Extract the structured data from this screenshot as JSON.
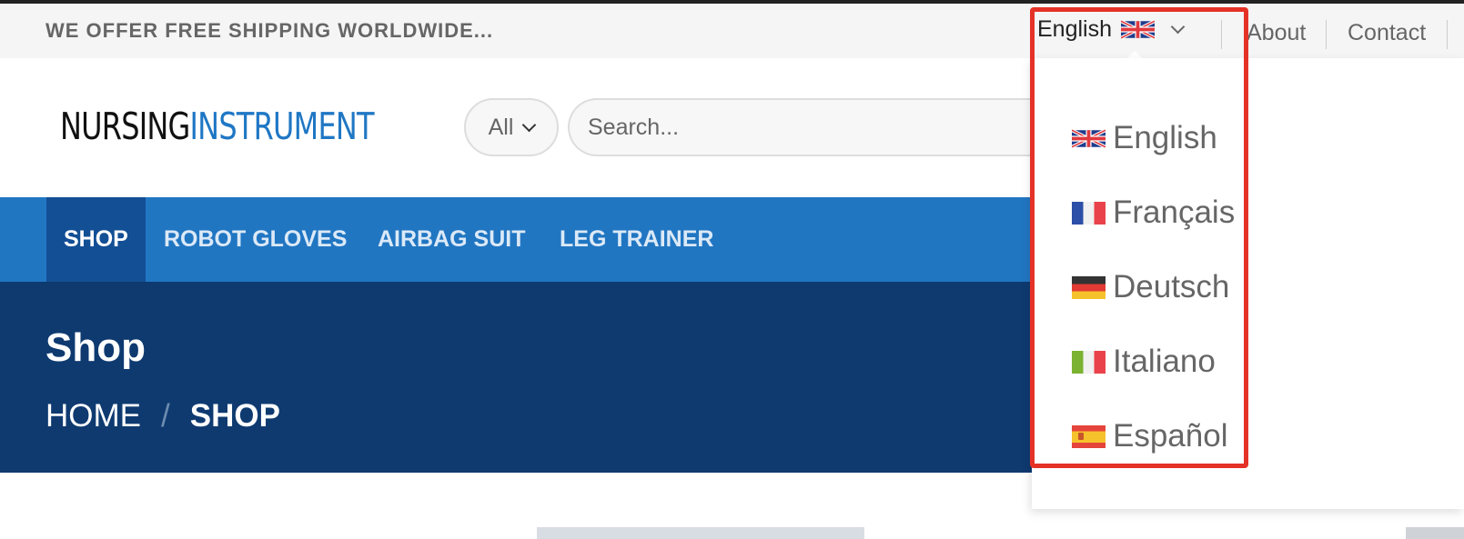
{
  "topbar": {
    "shipping_text": "WE OFFER FREE SHIPPING WORLDWIDE...",
    "language": {
      "current": "English",
      "flag_icon": "uk-flag-icon"
    },
    "links": [
      "About",
      "Contact"
    ]
  },
  "header": {
    "logo": {
      "part1": "NURSING",
      "part2": "INSTRUMENT"
    },
    "category_select": {
      "value": "All"
    },
    "search": {
      "placeholder": "Search..."
    }
  },
  "nav": {
    "items": [
      "SHOP",
      "ROBOT GLOVES",
      "AIRBAG SUIT",
      "LEG TRAINER"
    ],
    "active": "SHOP"
  },
  "banner": {
    "title": "Shop",
    "breadcrumb": {
      "home": "HOME",
      "separator": "/",
      "current": "SHOP"
    }
  },
  "language_dropdown": {
    "items": [
      {
        "label": "English",
        "flag": "uk-flag-icon"
      },
      {
        "label": "Français",
        "flag": "france-flag-icon"
      },
      {
        "label": "Deutsch",
        "flag": "germany-flag-icon"
      },
      {
        "label": "Italiano",
        "flag": "italy-flag-icon"
      },
      {
        "label": "Español",
        "flag": "spain-flag-icon"
      }
    ]
  },
  "colors": {
    "nav_bg": "#2176c2",
    "nav_active_bg": "#134f95",
    "banner_bg": "#0e3a70",
    "logo_accent": "#1f77c4",
    "highlight_border": "#e53227"
  }
}
